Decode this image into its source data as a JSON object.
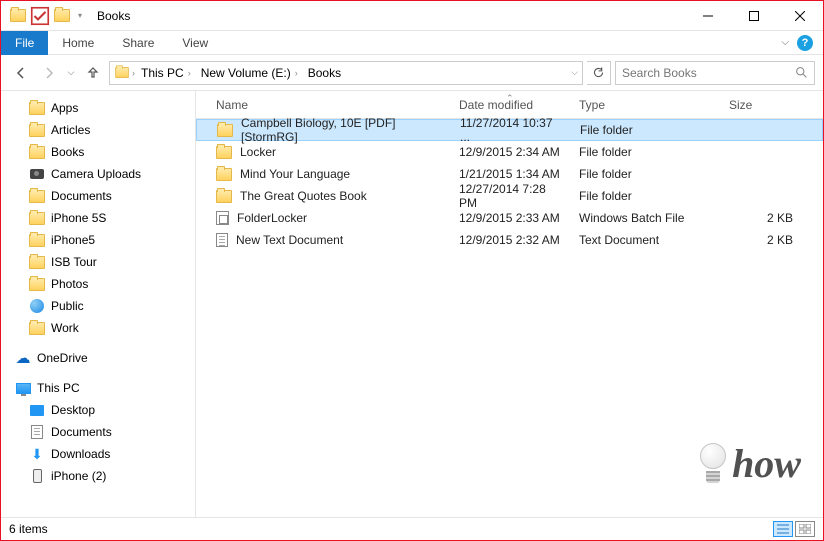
{
  "window": {
    "title": "Books"
  },
  "ribbon": {
    "file": "File",
    "home": "Home",
    "share": "Share",
    "view": "View"
  },
  "breadcrumbs": [
    "This PC",
    "New Volume (E:)",
    "Books"
  ],
  "search": {
    "placeholder": "Search Books"
  },
  "columns": {
    "name": "Name",
    "date": "Date modified",
    "type": "Type",
    "size": "Size"
  },
  "tree": {
    "quick": [
      {
        "label": "Apps",
        "icon": "folder"
      },
      {
        "label": "Articles",
        "icon": "folder"
      },
      {
        "label": "Books",
        "icon": "folder"
      },
      {
        "label": "Camera Uploads",
        "icon": "camera"
      },
      {
        "label": "Documents",
        "icon": "folder"
      },
      {
        "label": "iPhone 5S",
        "icon": "folder"
      },
      {
        "label": "iPhone5",
        "icon": "folder"
      },
      {
        "label": "ISB Tour",
        "icon": "folder"
      },
      {
        "label": "Photos",
        "icon": "folder"
      },
      {
        "label": "Public",
        "icon": "globe"
      },
      {
        "label": "Work",
        "icon": "folder"
      }
    ],
    "onedrive": {
      "label": "OneDrive"
    },
    "thispc": {
      "label": "This PC"
    },
    "pcitems": [
      {
        "label": "Desktop",
        "icon": "desktop"
      },
      {
        "label": "Documents",
        "icon": "doc"
      },
      {
        "label": "Downloads",
        "icon": "download"
      },
      {
        "label": "iPhone (2)",
        "icon": "phone"
      }
    ]
  },
  "files": [
    {
      "name": "Campbell Biology, 10E [PDF] [StormRG]",
      "date": "11/27/2014 10:37 ...",
      "type": "File folder",
      "size": "",
      "icon": "folder",
      "selected": true
    },
    {
      "name": "Locker",
      "date": "12/9/2015 2:34 AM",
      "type": "File folder",
      "size": "",
      "icon": "folder"
    },
    {
      "name": "Mind Your Language",
      "date": "1/21/2015 1:34 AM",
      "type": "File folder",
      "size": "",
      "icon": "folder"
    },
    {
      "name": "The Great Quotes Book",
      "date": "12/27/2014 7:28 PM",
      "type": "File folder",
      "size": "",
      "icon": "folder"
    },
    {
      "name": "FolderLocker",
      "date": "12/9/2015 2:33 AM",
      "type": "Windows Batch File",
      "size": "2 KB",
      "icon": "bat"
    },
    {
      "name": "New Text Document",
      "date": "12/9/2015 2:32 AM",
      "type": "Text Document",
      "size": "2 KB",
      "icon": "txt"
    }
  ],
  "status": {
    "count": "6 items"
  },
  "watermark": {
    "text": "how"
  }
}
